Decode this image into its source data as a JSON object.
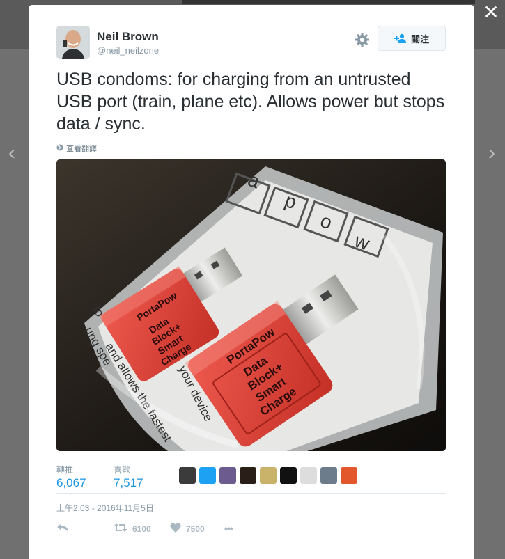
{
  "modal": {
    "close_glyph": "✕",
    "prev_glyph": "‹",
    "next_glyph": "›"
  },
  "author": {
    "name": "Neil Brown",
    "handle": "@neil_neilzone"
  },
  "follow_button": {
    "label": "關注"
  },
  "tweet": {
    "text": "USB condoms: for charging from an untrusted USB port (train, plane etc). Allows power but stops data / sync.",
    "translate_label": "查看翻譯"
  },
  "photo": {
    "adapter_brand": "PortaPow",
    "adapter_label_lines": [
      "Data",
      "Block+",
      "Smart",
      "Charge"
    ],
    "paper_letters": [
      "a",
      "p",
      "o",
      "w"
    ],
    "paper_lines": [
      "to",
      "ung spe",
      "and allows the fastest",
      "your device"
    ]
  },
  "stats": {
    "retweets_label": "轉推",
    "retweets_count": "6,067",
    "likes_label": "喜歡",
    "likes_count": "7,517",
    "liker_colors": [
      "#3b3b3b",
      "#1da1f2",
      "#6b5b8e",
      "#2a1f18",
      "#c9b36a",
      "#111111",
      "#dddddd",
      "#6d7c8a",
      "#e2572c"
    ]
  },
  "timestamp": "上午2:03 - 2016年11月5日",
  "actions": {
    "retweet_count": "6100",
    "like_count": "7500",
    "more_glyph": "•••"
  }
}
